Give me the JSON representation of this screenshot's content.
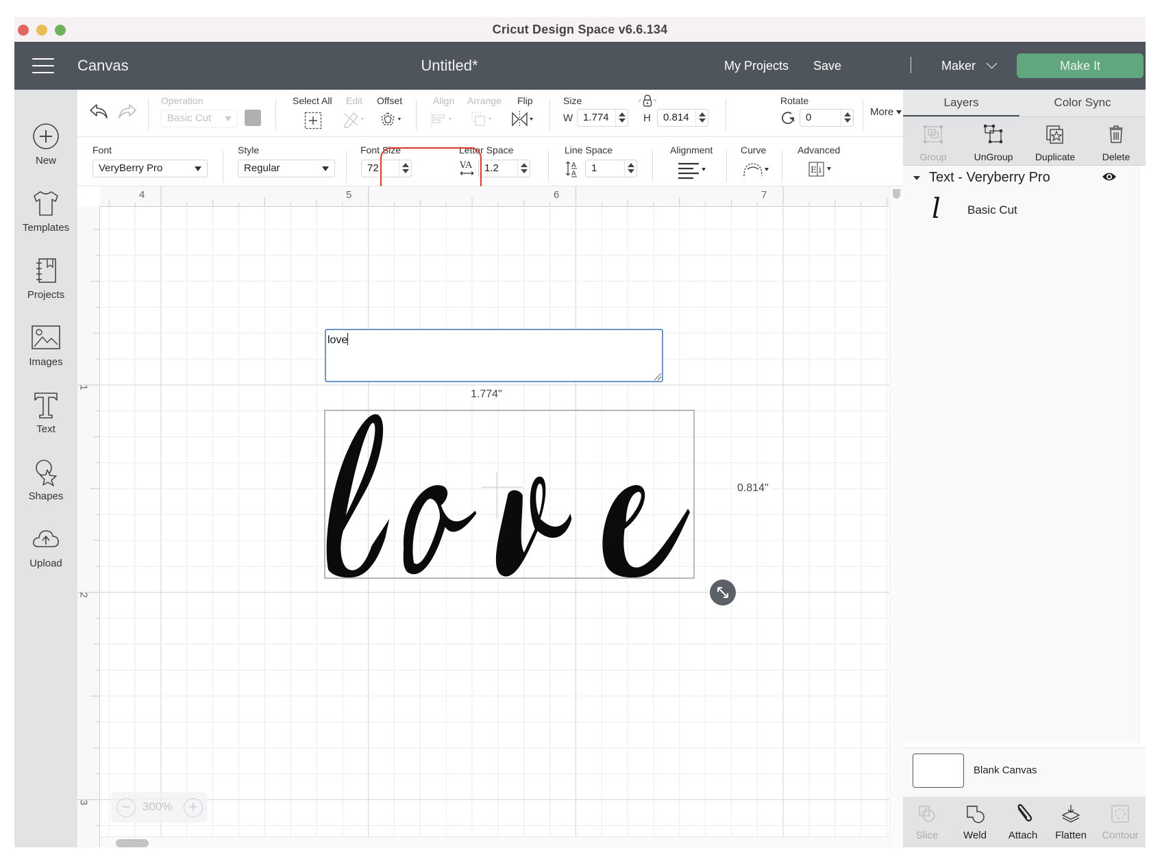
{
  "window": {
    "title": "Cricut Design Space  v6.6.134"
  },
  "header": {
    "section": "Canvas",
    "document_title": "Untitled*",
    "my_projects": "My Projects",
    "save": "Save",
    "separator": "|",
    "machine": "Maker",
    "make_it": "Make It",
    "make_it_color": "#62a67e"
  },
  "sidebar": {
    "items": [
      {
        "label": "New",
        "icon": "plus-circle-icon"
      },
      {
        "label": "Templates",
        "icon": "tshirt-icon"
      },
      {
        "label": "Projects",
        "icon": "notebook-icon"
      },
      {
        "label": "Images",
        "icon": "image-icon"
      },
      {
        "label": "Text",
        "icon": "text-icon"
      },
      {
        "label": "Shapes",
        "icon": "shapes-icon"
      },
      {
        "label": "Upload",
        "icon": "cloud-upload-icon"
      }
    ]
  },
  "toolbar": {
    "operation_label": "Operation",
    "operation_value": "Basic Cut",
    "select_all": "Select All",
    "edit": "Edit",
    "offset": "Offset",
    "align": "Align",
    "arrange": "Arrange",
    "flip": "Flip",
    "size_label": "Size",
    "width_label": "W",
    "width_value": "1.774",
    "height_label": "H",
    "height_value": "0.814",
    "rotate_label": "Rotate",
    "rotate_value": "0",
    "more": "More"
  },
  "text_toolbar": {
    "font_label": "Font",
    "font_value": "VeryBerry Pro",
    "style_label": "Style",
    "style_value": "Regular",
    "font_size_label": "Font Size",
    "font_size_value": "72",
    "letter_space_label": "Letter Space",
    "letter_space_value": "1.2",
    "line_space_label": "Line Space",
    "line_space_value": "1",
    "alignment_label": "Alignment",
    "curve_label": "Curve",
    "advanced_label": "Advanced",
    "highlight_color": "#d63a2f"
  },
  "canvas": {
    "ruler_x": [
      "4",
      "5",
      "6",
      "7"
    ],
    "ruler_y": [
      "1",
      "2",
      "3"
    ],
    "text_input_value": "love",
    "rendered_text": "love",
    "width_dimension": "1.774\"",
    "height_dimension": "0.814\"",
    "zoom_level": "300%",
    "zoom_out": "−",
    "zoom_in": "+"
  },
  "right_panel": {
    "tabs": [
      {
        "label": "Layers",
        "active": true
      },
      {
        "label": "Color Sync",
        "active": false
      }
    ],
    "actions": [
      {
        "label": "Group",
        "enabled": false
      },
      {
        "label": "UnGroup",
        "enabled": true
      },
      {
        "label": "Duplicate",
        "enabled": true
      },
      {
        "label": "Delete",
        "enabled": true
      }
    ],
    "layer_group": "Text - Veryberry Pro",
    "layer_item_glyph": "l",
    "layer_item_name": "Basic Cut",
    "blank_canvas": "Blank Canvas",
    "bottom_actions": [
      {
        "label": "Slice",
        "enabled": false
      },
      {
        "label": "Weld",
        "enabled": true
      },
      {
        "label": "Attach",
        "enabled": true
      },
      {
        "label": "Flatten",
        "enabled": true
      },
      {
        "label": "Contour",
        "enabled": false
      }
    ]
  }
}
